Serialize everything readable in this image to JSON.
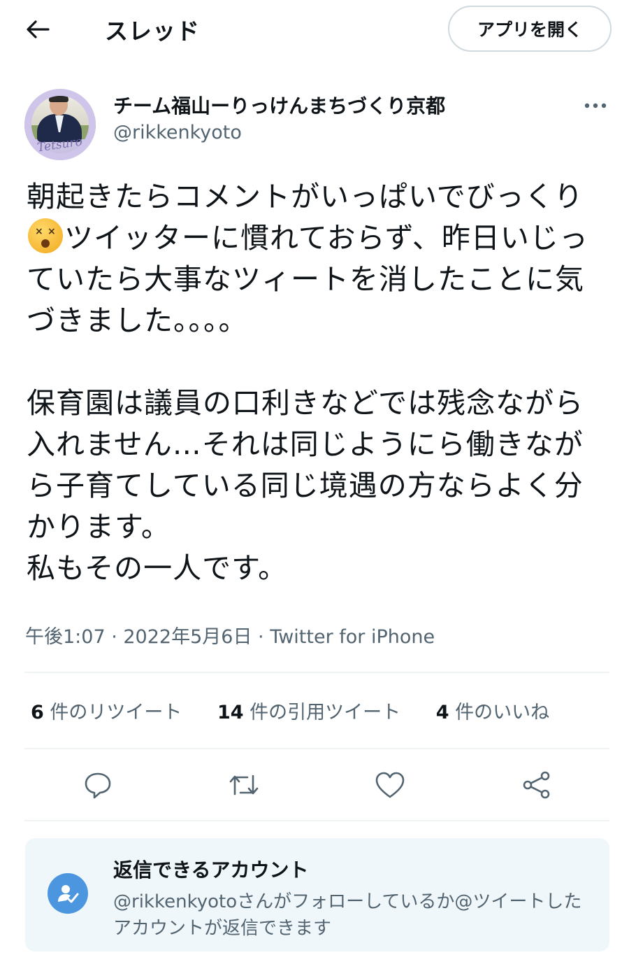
{
  "header": {
    "title": "スレッド",
    "open_app_label": "アプリを開く"
  },
  "author": {
    "name": "チーム福山ーりっけんまちづくり京都",
    "handle": "@rikkenkyoto",
    "avatar_script": "Tetsuro"
  },
  "tweet": {
    "line1_a": "朝起きたらコメントがいっぱいでびっく",
    "line1_b": "り",
    "emoji": "dizzy-face-emoji",
    "line1_c": "ツイッターに慣れておらず、昨日いじっていたら大事なツィートを消したことに気づきました。。。。",
    "paragraph2": "保育園は議員の口利きなどでは残念ながら入れません…それは同じようにら働きながら子育てしている同じ境遇の方ならよく分かります。",
    "paragraph3": "私もその一人です。"
  },
  "meta": "午後1:07 · 2022年5月6日 · Twitter for iPhone",
  "stats": {
    "retweets_count": "6",
    "retweets_label": "件のリツイート",
    "quotes_count": "14",
    "quotes_label": "件の引用ツイート",
    "likes_count": "4",
    "likes_label": "件のいいね"
  },
  "actions": {
    "reply_icon": "reply-icon",
    "retweet_icon": "retweet-icon",
    "like_icon": "heart-icon",
    "share_icon": "share-icon"
  },
  "reply_restriction": {
    "title": "返信できるアカウント",
    "description": "@rikkenkyotoさんがフォローしているか@ツイートしたアカウントが返信できます"
  },
  "colors": {
    "text": "#0f1419",
    "secondary": "#536471",
    "divider": "#eff3f4",
    "card_bg": "#f0f7fb",
    "accent": "#4c96df"
  }
}
